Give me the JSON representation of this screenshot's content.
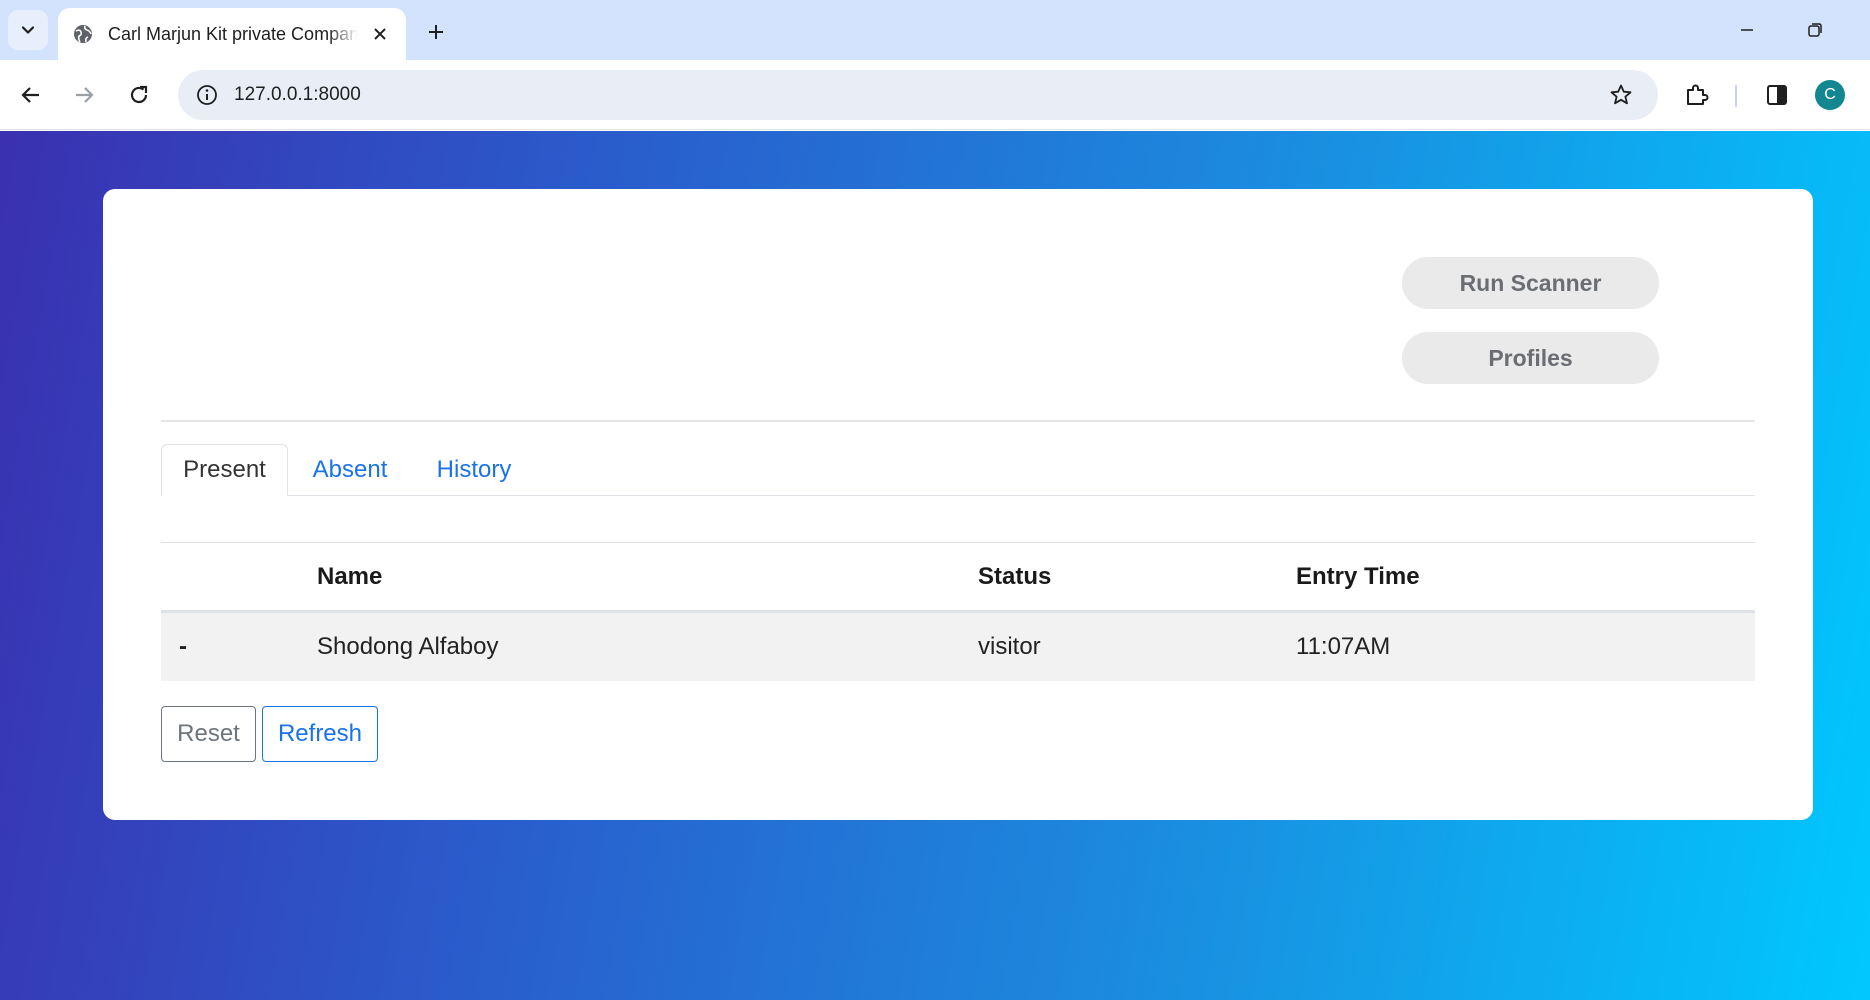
{
  "browser": {
    "tab_title": "Carl Marjun Kit private Company",
    "url": "127.0.0.1:8000",
    "avatar_letter": "C"
  },
  "actions": {
    "run_scanner": "Run Scanner",
    "profiles": "Profiles"
  },
  "tabs": [
    {
      "label": "Present",
      "active": true
    },
    {
      "label": "Absent",
      "active": false
    },
    {
      "label": "History",
      "active": false
    }
  ],
  "table": {
    "headers": [
      "",
      "Name",
      "Status",
      "Entry Time"
    ],
    "rows": [
      {
        "marker": "-",
        "name": "Shodong Alfaboy",
        "status": "visitor",
        "entry_time": "11:07AM"
      }
    ]
  },
  "buttons": {
    "reset": "Reset",
    "refresh": "Refresh"
  },
  "colors": {
    "link": "#1a73e8",
    "gradient_start": "#3a30b0",
    "gradient_end": "#00c8ff"
  }
}
